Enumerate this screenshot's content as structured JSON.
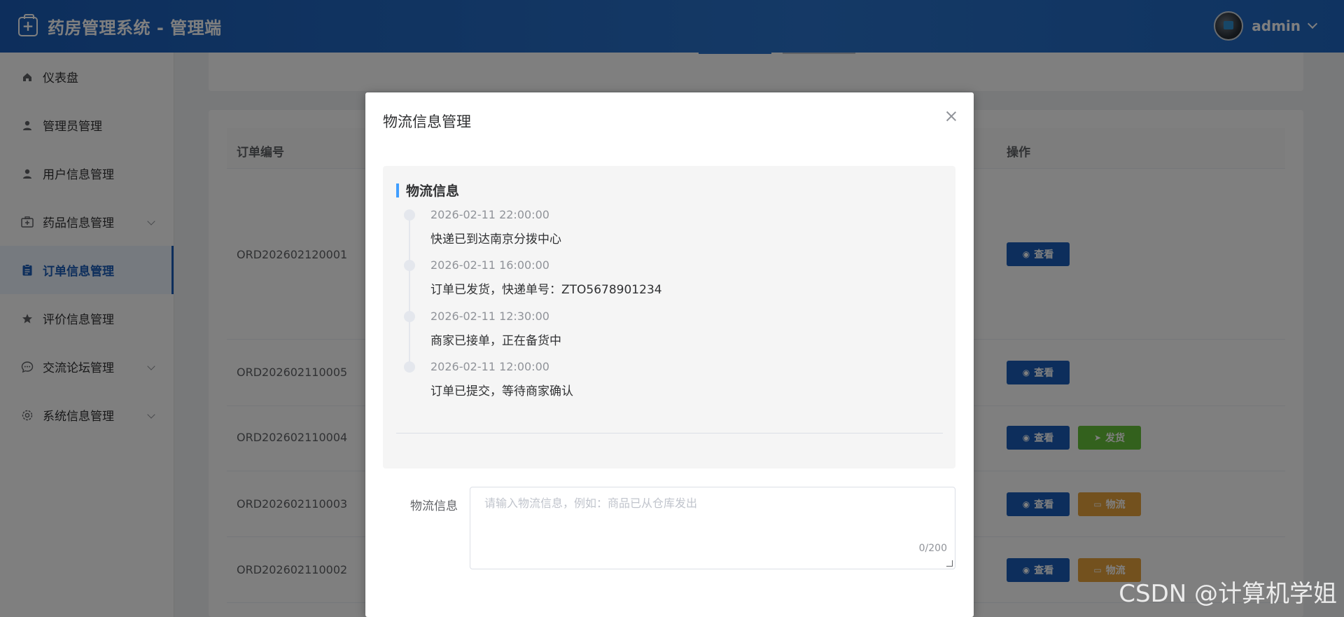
{
  "header": {
    "title": "药房管理系统 - 管理端",
    "username": "admin"
  },
  "sidebar": {
    "items": [
      {
        "label": "仪表盘",
        "icon": "home-icon"
      },
      {
        "label": "管理员管理",
        "icon": "user-icon"
      },
      {
        "label": "用户信息管理",
        "icon": "user-icon"
      },
      {
        "label": "药品信息管理",
        "icon": "medkit-icon"
      },
      {
        "label": "订单信息管理",
        "icon": "clipboard-icon"
      },
      {
        "label": "评价信息管理",
        "icon": "star-icon"
      },
      {
        "label": "交流论坛管理",
        "icon": "chat-icon"
      },
      {
        "label": "系统信息管理",
        "icon": "gear-icon"
      }
    ]
  },
  "table": {
    "headers": {
      "order_no": "订单编号",
      "actions": "操作"
    },
    "rows": [
      {
        "order": "ORD202602120001",
        "view": "查看"
      },
      {
        "order": "ORD202602110005",
        "view": "查看"
      },
      {
        "order": "ORD202602110004",
        "view": "查看",
        "ship": "发货"
      },
      {
        "order": "ORD202602110003",
        "view": "查看",
        "logistics": "物流"
      },
      {
        "order": "ORD202602110002",
        "view": "查看",
        "logistics": "物流"
      }
    ]
  },
  "dialog": {
    "title": "物流信息管理",
    "panel_title": "物流信息",
    "timeline": [
      {
        "time": "2026-02-11 22:00:00",
        "text": "快递已到达南京分拨中心"
      },
      {
        "time": "2026-02-11 16:00:00",
        "text": "订单已发货，快递单号：ZTO5678901234"
      },
      {
        "time": "2026-02-11 12:30:00",
        "text": "商家已接单，正在备货中"
      },
      {
        "time": "2026-02-11 12:00:00",
        "text": "订单已提交，等待商家确认"
      }
    ],
    "form": {
      "label": "物流信息",
      "placeholder": "请输入物流信息，例如：商品已从仓库发出",
      "counter": "0/200"
    }
  },
  "watermark": "CSDN @计算机学姐"
}
